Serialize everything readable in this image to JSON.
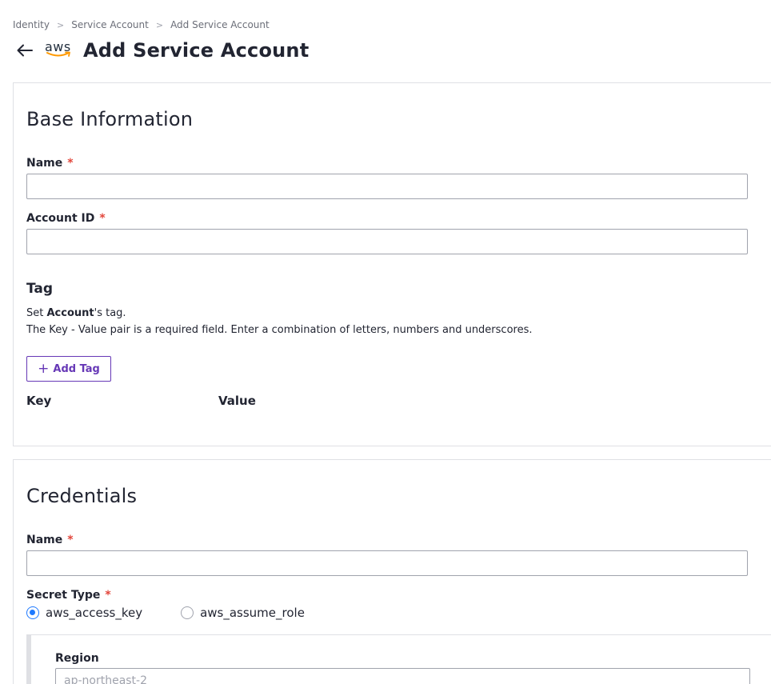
{
  "breadcrumb": {
    "items": [
      "Identity",
      "Service Account",
      "Add Service Account"
    ],
    "separator": ">"
  },
  "header": {
    "back_icon": "arrow-left-icon",
    "provider_logo": "aws",
    "title": "Add Service Account"
  },
  "base_info": {
    "section_title": "Base Information",
    "name": {
      "label": "Name",
      "required_mark": "*",
      "value": ""
    },
    "account_id": {
      "label": "Account ID",
      "required_mark": "*",
      "value": ""
    },
    "tag": {
      "title": "Tag",
      "desc_prefix": "Set ",
      "desc_bold": "Account",
      "desc_suffix": "'s tag.",
      "desc_line2": "The Key - Value pair is a required field. Enter a combination of letters, numbers and underscores.",
      "add_button_icon": "plus-icon",
      "add_button_label": "Add Tag",
      "columns": {
        "key": "Key",
        "value": "Value"
      }
    }
  },
  "credentials": {
    "section_title": "Credentials",
    "name": {
      "label": "Name",
      "required_mark": "*",
      "value": ""
    },
    "secret_type": {
      "label": "Secret Type",
      "required_mark": "*",
      "options": [
        {
          "label": "aws_access_key",
          "selected": true
        },
        {
          "label": "aws_assume_role",
          "selected": false
        }
      ]
    },
    "region": {
      "label": "Region",
      "placeholder": "ap-northeast-2"
    }
  },
  "colors": {
    "accent": "#6638b6",
    "radio_selected": "#1f7aff",
    "required": "#e2453a",
    "border": "#dfe0e4"
  }
}
